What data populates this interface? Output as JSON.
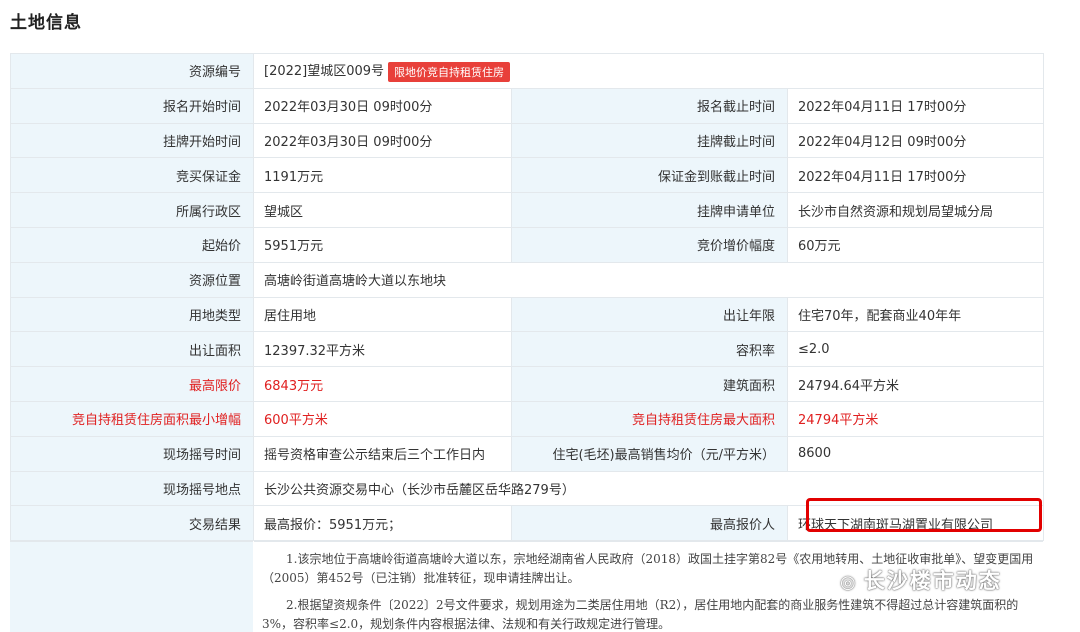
{
  "title": "土地信息",
  "resource": {
    "label": "资源编号",
    "value": "[2022]望城区009号",
    "tag": "限地价竞自持租赁住房"
  },
  "rows": [
    {
      "l1": "报名开始时间",
      "v1": "2022年03月30日 09时00分",
      "l2": "报名截止时间",
      "v2": "2022年04月11日 17时00分"
    },
    {
      "l1": "挂牌开始时间",
      "v1": "2022年03月30日 09时00分",
      "l2": "挂牌截止时间",
      "v2": "2022年04月12日 09时00分"
    },
    {
      "l1": "竞买保证金",
      "v1": "1191万元",
      "l2": "保证金到账截止时间",
      "v2": "2022年04月11日 17时00分"
    },
    {
      "l1": "所属行政区",
      "v1": "望城区",
      "l2": "挂牌申请单位",
      "v2": "长沙市自然资源和规划局望城分局"
    },
    {
      "l1": "起始价",
      "v1": "5951万元",
      "l2": "竞价增价幅度",
      "v2": "60万元"
    }
  ],
  "location": {
    "label": "资源位置",
    "value": "高塘岭街道高塘岭大道以东地块"
  },
  "rows2": [
    {
      "l1": "用地类型",
      "v1": "居住用地",
      "l2": "出让年限",
      "v2": "住宅70年，配套商业40年年"
    },
    {
      "l1": "出让面积",
      "v1": "12397.32平方米",
      "l2": "容积率",
      "v2": "≤2.0"
    },
    {
      "l1": "最高限价",
      "v1": "6843万元",
      "l2": "建筑面积",
      "v2": "24794.64平方米"
    },
    {
      "l1": "竞自持租赁住房面积最小增幅",
      "v1": "600平方米",
      "l2": "竞自持租赁住房最大面积",
      "v2": "24794平方米"
    },
    {
      "l1": "现场摇号时间",
      "v1": "摇号资格审查公示结束后三个工作日内",
      "l2": "住宅(毛坯)最高销售均价（元/平方米）",
      "v2": "8600"
    }
  ],
  "lottery_place": {
    "label": "现场摇号地点",
    "value": "长沙公共资源交易中心（长沙市岳麓区岳华路279号）"
  },
  "result": {
    "label": "交易结果",
    "value": "最高报价：5951万元；",
    "l2": "最高报价人",
    "v2": "环球天下湖南斑马湖置业有限公司"
  },
  "notes": [
    "1.该宗地位于高塘岭街道高塘岭大道以东，宗地经湖南省人民政府（2018）政国土挂字第82号《农用地转用、土地征收审批单》、望变更国用（2005）第452号（已注销）批准转征，现申请挂牌出让。",
    "2.根据望资规条件〔2022〕2号文件要求，规划用途为二类居住用地（R2），居住用地内配套的商业服务性建筑不得超过总计容建筑面积的3%，容积率≤2.0，规划条件内容根据法律、法规和有关行政规定进行管理。"
  ],
  "watermark": "长沙楼市动态",
  "colors": {
    "label_bg": "#edf6fb",
    "accent_red": "#e02020",
    "tag_bg": "#e8403a",
    "highlight_border": "#e20000"
  }
}
